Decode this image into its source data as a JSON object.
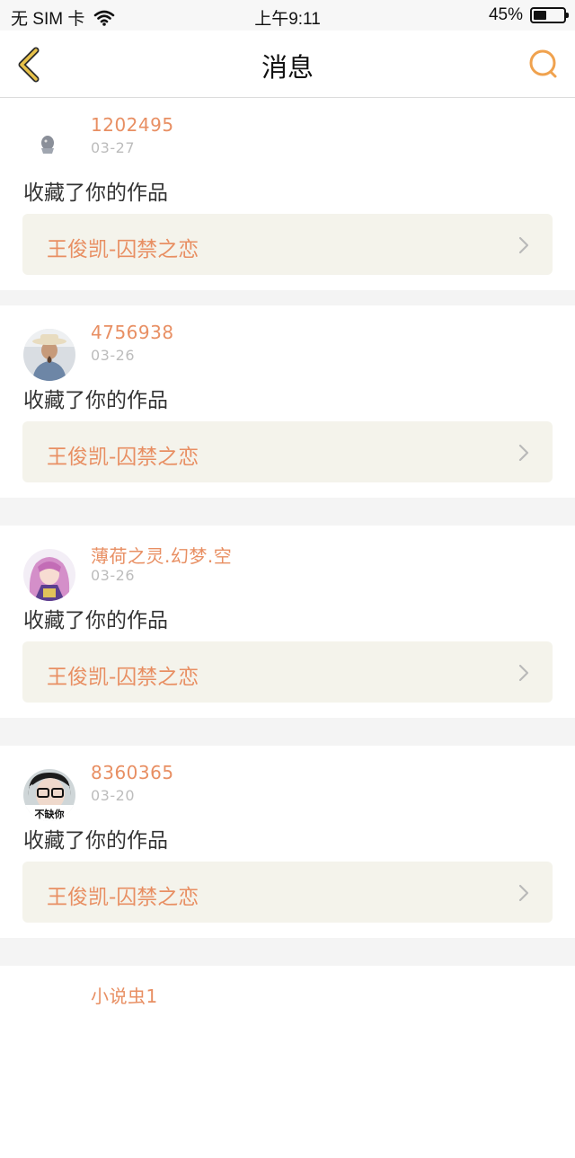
{
  "status_bar": {
    "carrier": "无 SIM 卡",
    "time": "上午9:11",
    "battery": "45%",
    "battery_level": 0.45
  },
  "nav": {
    "title": "消息",
    "back_icon": "chevron-left-icon",
    "search_icon": "search-icon",
    "accent_color": "#e8b84a"
  },
  "messages": [
    {
      "username": "1202495",
      "date": "03-27",
      "action": "收藏了你的作品",
      "work": "王俊凯-囚禁之恋",
      "avatar": "small-gray-figure-avatar"
    },
    {
      "username": "4756938",
      "date": "03-26",
      "action": "收藏了你的作品",
      "work": "王俊凯-囚禁之恋",
      "avatar": "man-with-hat-avatar"
    },
    {
      "username": "薄荷之灵.幻梦.空",
      "date": "03-26",
      "action": "收藏了你的作品",
      "work": "王俊凯-囚禁之恋",
      "avatar": "anime-girl-avatar"
    },
    {
      "username": "8360365",
      "date": "03-20",
      "action": "收藏了你的作品",
      "work": "王俊凯-囚禁之恋",
      "avatar": "glasses-person-avatar",
      "avatar_text": "不缺你"
    },
    {
      "username": "小说虫1",
      "date": "",
      "action": "",
      "work": "",
      "avatar": ""
    }
  ],
  "colors": {
    "username": "#e88f63",
    "date": "#bcbcbc",
    "work_bg": "#f4f3eb",
    "page_bg": "#f4f4f4"
  }
}
